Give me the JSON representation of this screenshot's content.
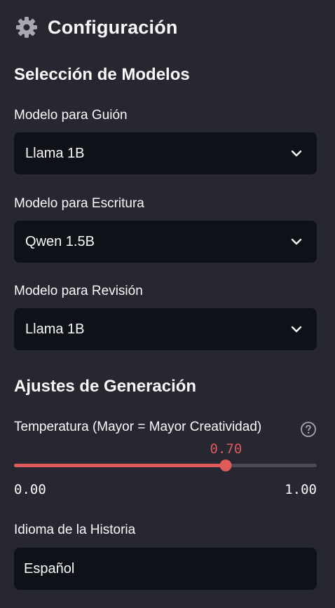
{
  "sidebar": {
    "title": "Configuración",
    "title_icon": "gear-icon",
    "model_section": {
      "heading": "Selección de Modelos",
      "selects": [
        {
          "label": "Modelo para Guión",
          "value": "Llama 1B"
        },
        {
          "label": "Modelo para Escritura",
          "value": "Qwen 1.5B"
        },
        {
          "label": "Modelo para Revisión",
          "value": "Llama 1B"
        }
      ]
    },
    "generation_section": {
      "heading": "Ajustes de Generación",
      "temperature": {
        "label": "Temperatura (Mayor = Mayor Creatividad)",
        "help_icon": "help-circle-icon",
        "value": 0.7,
        "value_text": "0.70",
        "min": 0.0,
        "min_text": "0.00",
        "max": 1.0,
        "max_text": "1.00"
      },
      "language": {
        "label": "Idioma de la Historia",
        "value": "Español"
      }
    }
  },
  "colors": {
    "background": "#262730",
    "input_background": "#0e1117",
    "accent": "#e05a5a",
    "text": "#fafafa",
    "track": "#4a4b57"
  }
}
